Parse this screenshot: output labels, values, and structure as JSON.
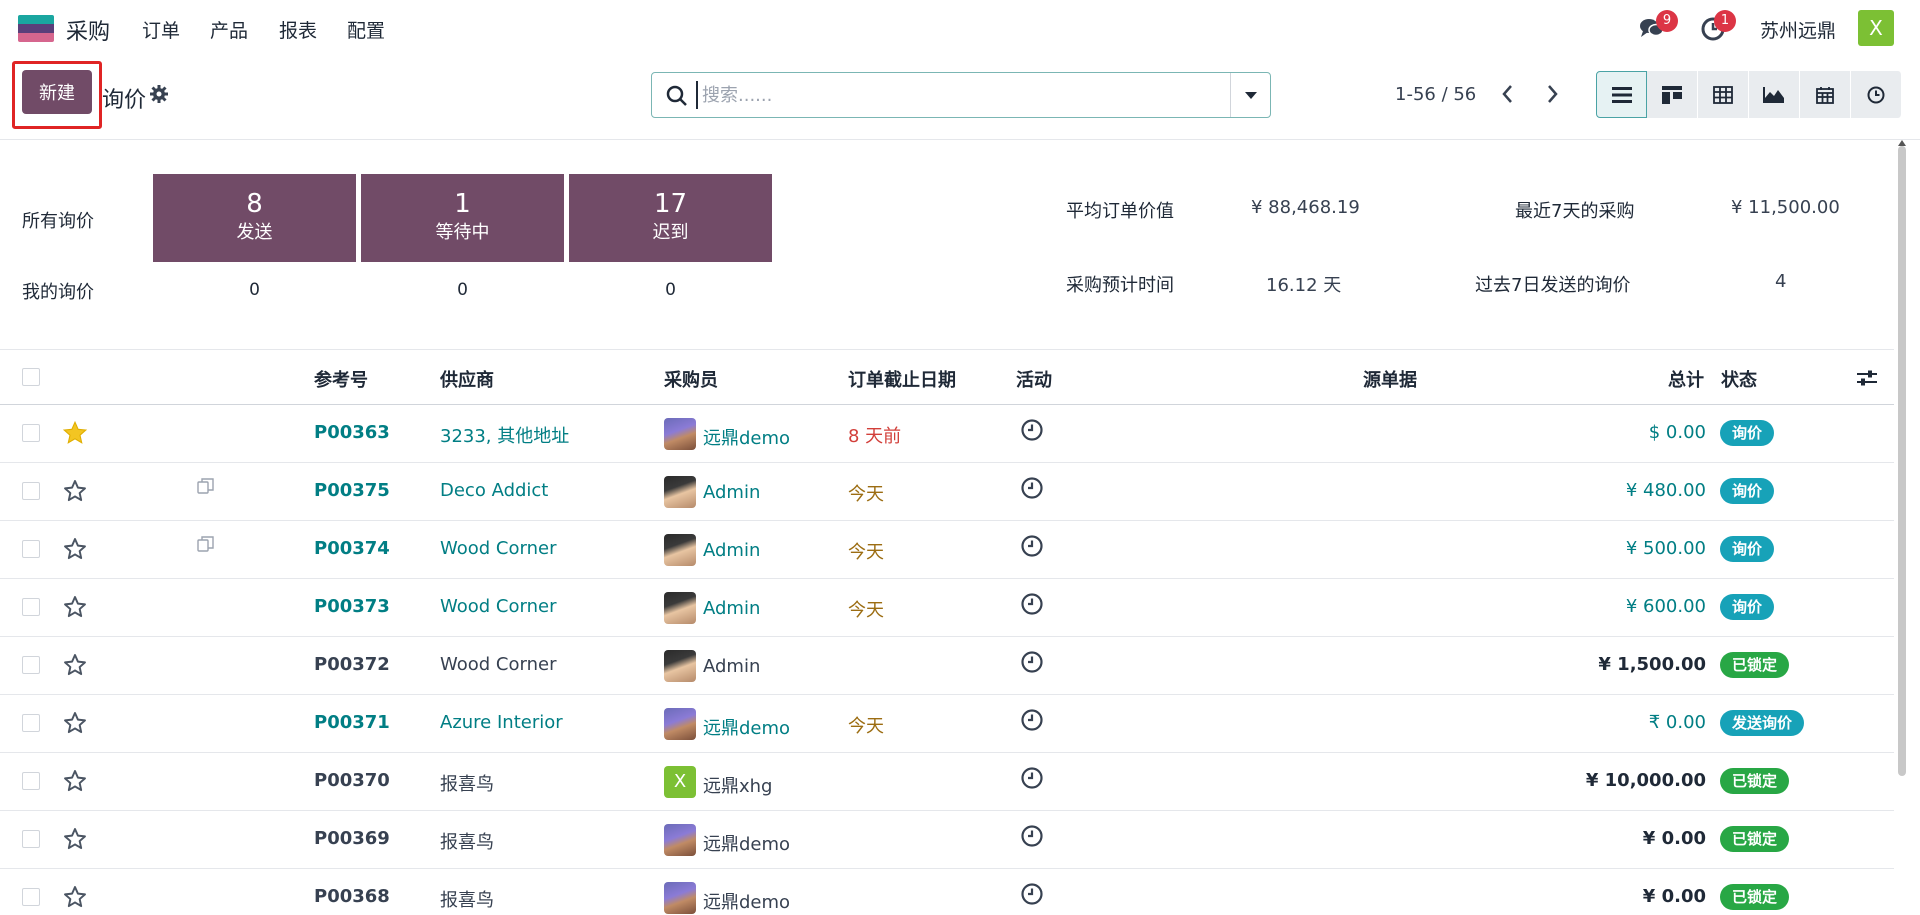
{
  "nav": {
    "app_name": "采购",
    "menu": [
      "订单",
      "产品",
      "报表",
      "配置"
    ],
    "messages_count": "9",
    "activities_count": "1",
    "company": "苏州远鼎",
    "user_initial": "X"
  },
  "control": {
    "new_label": "新建",
    "title": "询价",
    "search_placeholder": "搜索......",
    "pager": "1-56 / 56"
  },
  "dashboard": {
    "all_rfq_label": "所有询价",
    "my_rfq_label": "我的询价",
    "tiles": [
      {
        "count": "8",
        "label": "发送",
        "mine": "0"
      },
      {
        "count": "1",
        "label": "等待中",
        "mine": "0"
      },
      {
        "count": "17",
        "label": "迟到",
        "mine": "0"
      }
    ],
    "stats": {
      "avg_order_label": "平均订单价值",
      "avg_order_value": "¥ 88,468.19",
      "last7_purchase_label": "最近7天的采购",
      "last7_purchase_value": "¥ 11,500.00",
      "lead_time_label": "采购预计时间",
      "lead_time_value": "16.12 天",
      "rfq_sent_label": "过去7日发送的询价",
      "rfq_sent_value": "4"
    }
  },
  "table": {
    "headers": {
      "reference": "参考号",
      "vendor": "供应商",
      "buyer": "采购员",
      "deadline": "订单截止日期",
      "activity": "活动",
      "source": "源单据",
      "total": "总计",
      "status": "状态"
    },
    "rows": [
      {
        "ref": "P00363",
        "vendor": "3233, 其他地址",
        "buyer": "远鼎demo",
        "deadline": "8 天前",
        "total": "$ 0.00",
        "status": "询价"
      },
      {
        "ref": "P00375",
        "vendor": "Deco Addict",
        "buyer": "Admin",
        "deadline": "今天",
        "total": "¥ 480.00",
        "status": "询价"
      },
      {
        "ref": "P00374",
        "vendor": "Wood Corner",
        "buyer": "Admin",
        "deadline": "今天",
        "total": "¥ 500.00",
        "status": "询价"
      },
      {
        "ref": "P00373",
        "vendor": "Wood Corner",
        "buyer": "Admin",
        "deadline": "今天",
        "total": "¥ 600.00",
        "status": "询价"
      },
      {
        "ref": "P00372",
        "vendor": "Wood Corner",
        "buyer": "Admin",
        "deadline": "",
        "total": "¥ 1,500.00",
        "status": "已锁定"
      },
      {
        "ref": "P00371",
        "vendor": "Azure Interior",
        "buyer": "远鼎demo",
        "deadline": "今天",
        "total": "₹ 0.00",
        "status": "发送询价"
      },
      {
        "ref": "P00370",
        "vendor": "报喜鸟",
        "buyer": "远鼎xhg",
        "deadline": "",
        "total": "¥ 10,000.00",
        "status": "已锁定"
      },
      {
        "ref": "P00369",
        "vendor": "报喜鸟",
        "buyer": "远鼎demo",
        "deadline": "",
        "total": "¥ 0.00",
        "status": "已锁定"
      },
      {
        "ref": "P00368",
        "vendor": "报喜鸟",
        "buyer": "远鼎demo",
        "deadline": "",
        "total": "¥ 0.00",
        "status": "已锁定"
      }
    ],
    "xhg_initial": "X"
  },
  "colors": {
    "brand": "#714b67",
    "link": "#017e84",
    "status_info": "#17a2b8",
    "status_locked": "#28a745",
    "late": "#d23f3a",
    "today": "#9c6d12"
  }
}
